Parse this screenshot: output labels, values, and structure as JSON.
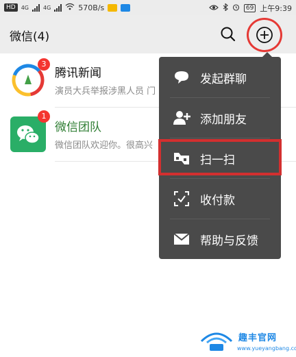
{
  "status_bar": {
    "network_badges": [
      "HD",
      "4G",
      "4G"
    ],
    "speed": "570B/s",
    "battery": "69",
    "time": "上午9:39"
  },
  "header": {
    "title": "微信(4)"
  },
  "chats": [
    {
      "name": "腾讯新闻",
      "preview": "演员大兵举报涉黑人员 门",
      "badge": "3"
    },
    {
      "name": "微信团队",
      "preview": "微信团队欢迎你。很高兴",
      "badge": "1"
    }
  ],
  "menu": {
    "items": [
      {
        "label": "发起群聊",
        "icon": "chat-bubble-icon"
      },
      {
        "label": "添加朋友",
        "icon": "add-friend-icon"
      },
      {
        "label": "扫一扫",
        "icon": "scan-icon"
      },
      {
        "label": "收付款",
        "icon": "payment-icon"
      },
      {
        "label": "帮助与反馈",
        "icon": "mail-icon"
      }
    ]
  },
  "watermark": {
    "title": "趣丰官网",
    "url": "www.yueyangbang.com"
  },
  "colors": {
    "header_bg": "#ededed",
    "menu_bg": "#4a4a4a",
    "badge": "#f43530",
    "highlight": "#e53935",
    "wechat_green": "#2aae67"
  }
}
